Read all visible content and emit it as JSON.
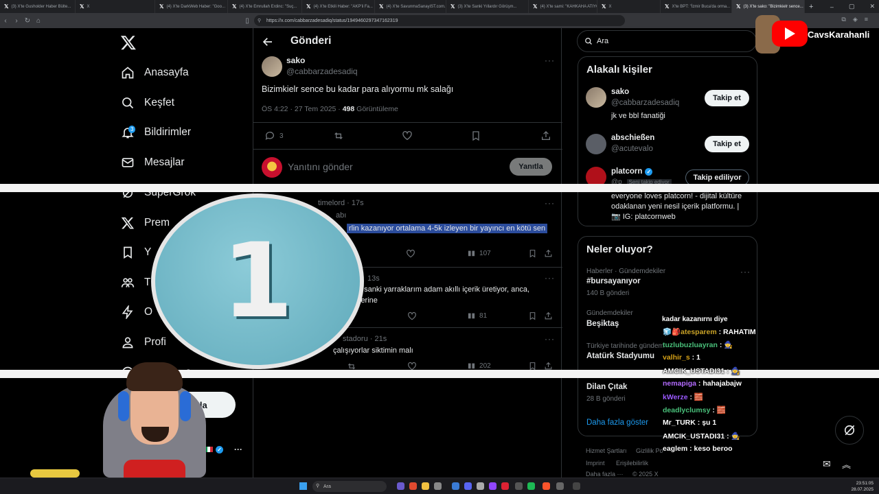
{
  "browser": {
    "tabs": [
      {
        "label": "(3) X'te Gusholder Haber Bülte...",
        "width": 110
      },
      {
        "label": "X",
        "width": 116
      },
      {
        "label": "(4) X'te DarkWeb Haber: \"Goo...",
        "width": 106
      },
      {
        "label": "(4) X'te Emrullah Erdinc: \"Suç...",
        "width": 108
      },
      {
        "label": "(4) X'te Etkili Haber: \"AKP'li Fa...",
        "width": 106
      },
      {
        "label": "(4) X'te SavunmaSanayiST.com...",
        "width": 104
      },
      {
        "label": "(3) X'te Sanki Yıllardır Görüşm...",
        "width": 120
      },
      {
        "label": "(4) X'te sami: \"KAHKAHA ATIYO...",
        "width": 100
      },
      {
        "label": "X",
        "width": 92
      },
      {
        "label": "X'te BPT: \"İzmir Buca'da orma...",
        "width": 104
      },
      {
        "label": "(3) X'te sako: \"Bizimkielr sence...",
        "width": 106,
        "active": true
      }
    ],
    "url": "https://x.com/cabbarzadesadiq/status/1949460297347162319"
  },
  "nav": {
    "home": "Anasayfa",
    "explore": "Keşfet",
    "notifications": "Bildirimler",
    "notif_count": "3",
    "messages": "Mesajlar",
    "grok": "SuperGrok",
    "premium": "Prem",
    "bookmarks": "Y",
    "communities": "T",
    "verified": "O",
    "profile": "Profi",
    "more": "a",
    "post_button": "ınla",
    "account_name": "nli"
  },
  "center": {
    "title": "Gönderi",
    "post": {
      "name": "sako",
      "handle": "@cabbarzadesadiq",
      "text": "Bizimkielr sence bu kadar para alıyormu mk salağı",
      "time": "ÖS 4:22 · 27 Tem 2025 · ",
      "views": "498",
      "views_label": " Görüntüleme",
      "reply_count": "3"
    },
    "reply_placeholder": "Yanıtını gönder",
    "reply_button": "Yanıtla",
    "replies": [
      {
        "header": "timelord · 17s",
        "sub": "abı",
        "text": "rlin kazanıyor ortalama 4-5k izleyen bir yayıncı en kötü sen",
        "views": "107"
      },
      {
        "header": "13s",
        "text": "r, sanki yarraklarım adam akıllı içerik üretiyor, anca,",
        "text2": "lerine",
        "views": "81"
      },
      {
        "header": "stadoru · 21s",
        "text": "çalışıyorlar siktimin malı",
        "views": "202"
      }
    ]
  },
  "right": {
    "search_placeholder": "Ara",
    "relevant_title": "Alakalı kişiler",
    "people": [
      {
        "name": "sako",
        "handle": "@cabbarzadesadiq",
        "bio": "jk ve bbl fanatiği",
        "button": "Takip et"
      },
      {
        "name": "abschießen",
        "handle": "@acutevalo",
        "button": "Takip et"
      },
      {
        "name": "platcorn",
        "handle": "@p",
        "follows_you": "Seni takip ediyor",
        "button": "Takip ediliyor",
        "bio": "everyone loves platcorn! - dijital kültüre odaklanan yeni nesil içerik platformu. | 📷 IG: platcornweb"
      }
    ],
    "trends_title": "Neler oluyor?",
    "trends": [
      {
        "category": "Haberler · Gündemdekiler",
        "tag": "#bursayanıyor",
        "count": "140 B gönderi"
      },
      {
        "category": "Gündemdekiler",
        "tag": "Beşiktaş"
      },
      {
        "category": "Türkiye tarihinde gündem",
        "tag": "Atatürk Stadyumu"
      },
      {
        "tag": "Dilan Çıtak",
        "count": "28 B gönderi"
      }
    ],
    "show_more": "Daha fazla göster",
    "footer": {
      "terms": "Hizmet Şartları",
      "privacy": "Gizlilik Po",
      "imprint": "Imprint",
      "access": "Erişilebilirlik",
      "more": "Daha fazla ···",
      "copy": "© 2025 X"
    }
  },
  "overlay": {
    "badge_number": "1",
    "streamer_name": "CavsKarahanli",
    "chat_header": "kadar kazanırnı diye",
    "chat": [
      {
        "user": "atesparem",
        "msg": "RAHATIM",
        "color": "#c9a227",
        "emotes": "🧊🎒"
      },
      {
        "user": "tuzlubuzluayran",
        "msg": "🧙",
        "color": "#49c07a"
      },
      {
        "user": "valhir_s",
        "msg": "1",
        "color": "#d4a017"
      },
      {
        "user": "AMCIK_USTADI31",
        "msg": "🧙",
        "color": "#ffffff"
      },
      {
        "user": "nemapiga",
        "msg": "hahajabajw",
        "color": "#b36bff"
      },
      {
        "user": "kWerze",
        "msg": "🧱",
        "color": "#9b59ff"
      },
      {
        "user": "deadlyclumsy",
        "msg": "🧱",
        "color": "#49c07a"
      },
      {
        "user": "Mr_TURK",
        "msg": "şu 1",
        "color": "#ffffff"
      },
      {
        "user": "AMCIK_USTADI31",
        "msg": "🧙",
        "color": "#ffffff"
      },
      {
        "user": "eaglem",
        "msg": "keso beroo",
        "color": "#ffffff"
      }
    ]
  },
  "taskbar": {
    "search": "Ara",
    "time": "23:51:05",
    "date": "28.07.2025"
  }
}
